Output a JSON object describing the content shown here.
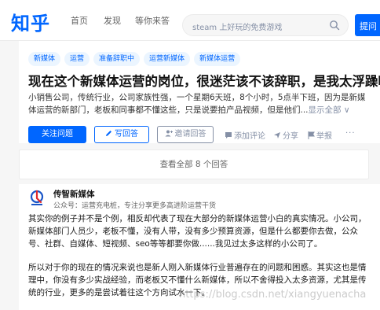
{
  "header": {
    "logo": "知乎",
    "nav": [
      "首页",
      "发现",
      "等你来答"
    ],
    "search_placeholder": "steam 上好玩的免费游戏",
    "ask_label": "提问"
  },
  "question": {
    "tags": [
      "新媒体",
      "运营",
      "准备辞职中",
      "运营新媒体",
      "新媒体运营"
    ],
    "title": "现在这个新媒体运营的岗位，很迷茫该不该辞职，是我太浮躁吗?",
    "description": "小销售公司，传统行业，公司家族性强，一个星期6天班，8个小时，5点半下班，因为是新媒体运营的新部门，老板和同事都不懂这些，只是说要拍产品视频，但是他们...",
    "show_all": "显示全部 ∨",
    "follow_label": "关注问题",
    "answer_label": "写回答",
    "invite_label": "邀请回答",
    "comment_label": "添加评论",
    "share_label": "分享",
    "report_label": "举报",
    "more_label": "···"
  },
  "view_all": "查看全部 8 个回答",
  "answer": {
    "author": "传智新媒体",
    "bio": "公众号：运营充电桩，专注分享更多高进阶运营干货",
    "para1": "其实你的例子并不是个例，相反却代表了现在大部分的新媒体运营小白的真实情况。小公司，新媒体部门人员少，老板不懂，没有人带，没有多少预算资源，但是什么都要你去做，公众号、社群、自媒体、短视频、seo等等都要你做......我见过太多这样的小公司了。",
    "para2": "所以对于你的现在的情况来说也是新人刚入新媒体行业普遍存在的问题和困惑。其实这也是情理中，你没有多少实战经验，而老板又不懂什么新媒体，所以不舍得投入太多资源，尤其是传统的行业，更多的是尝试着往这个方向试水一下。"
  },
  "watermark": "https://blog.csdn.net/xiangyuenacha",
  "colors": {
    "brand": "#0066ff",
    "tag_bg": "#ebf5ff",
    "muted": "#8590a6"
  }
}
